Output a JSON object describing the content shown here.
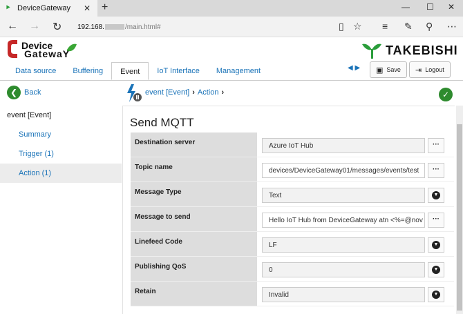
{
  "browser": {
    "tab_title": "DeviceGateway",
    "url_host": "192.168.",
    "url_path": "/main.html#"
  },
  "app": {
    "logo_line1": "Device",
    "logo_line2": "GatewaY",
    "brand": "TAKEBISHI",
    "tabs": [
      "Data source",
      "Buffering",
      "Event",
      "IoT Interface",
      "Management"
    ],
    "active_tab": "Event",
    "save_label": "Save",
    "logout_label": "Logout"
  },
  "breadcrumb": {
    "back_label": "Back",
    "item1": "event",
    "item2": "[Event]",
    "item3": "Action"
  },
  "sidebar": {
    "header": "event  [Event]",
    "items": [
      "Summary",
      "Trigger (1)",
      "Action (1)"
    ]
  },
  "panel": {
    "title": "Send MQTT",
    "fields": [
      {
        "label": "Destination server",
        "value": "Azure IoT Hub",
        "control": "ellipsis"
      },
      {
        "label": "Topic name",
        "value": "devices/DeviceGateway01/messages/events/test",
        "control": "ellipsis"
      },
      {
        "label": "Message Type",
        "value": "Text",
        "control": "dropdown"
      },
      {
        "label": "Message to send",
        "value": "Hello IoT Hub from DeviceGateway atn <%=@nov",
        "control": "ellipsis"
      },
      {
        "label": "Linefeed Code",
        "value": "LF",
        "control": "dropdown"
      },
      {
        "label": "Publishing QoS",
        "value": "0",
        "control": "dropdown"
      },
      {
        "label": "Retain",
        "value": "Invalid",
        "control": "dropdown"
      }
    ]
  },
  "colors": {
    "accent": "#1a73b8",
    "ok_green": "#2e8b2e"
  }
}
